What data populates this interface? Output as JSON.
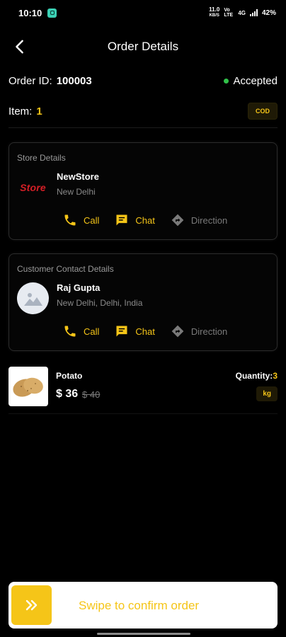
{
  "status_bar": {
    "time": "10:10",
    "speed": "11.0",
    "speed_unit": "KB/S",
    "net1": "Vo LTE",
    "net2": "4G",
    "battery": "42%"
  },
  "header": {
    "title": "Order Details"
  },
  "order": {
    "id_label": "Order ID:",
    "id_value": "100003",
    "status": "Accepted",
    "status_color": "#31c24a",
    "item_label": "Item:",
    "item_count": "1",
    "payment_badge": "COD"
  },
  "store": {
    "section_title": "Store Details",
    "logo_text": "Store",
    "name": "NewStore",
    "address": "New Delhi",
    "actions": {
      "call": "Call",
      "chat": "Chat",
      "direction": "Direction"
    }
  },
  "customer": {
    "section_title": "Customer Contact Details",
    "name": "Raj Gupta",
    "address": "New Delhi, Delhi, India",
    "actions": {
      "call": "Call",
      "chat": "Chat",
      "direction": "Direction"
    }
  },
  "product": {
    "name": "Potato",
    "price": "$ 36",
    "old_price": "$ 40",
    "quantity_label": "Quantity:",
    "quantity_value": "3",
    "unit": "kg"
  },
  "swipe": {
    "label": "Swipe to confirm order",
    "knob_icon": "double-chevron-right-icon"
  },
  "colors": {
    "accent": "#f5c518",
    "background": "#000000",
    "muted": "#8a8a8a"
  }
}
